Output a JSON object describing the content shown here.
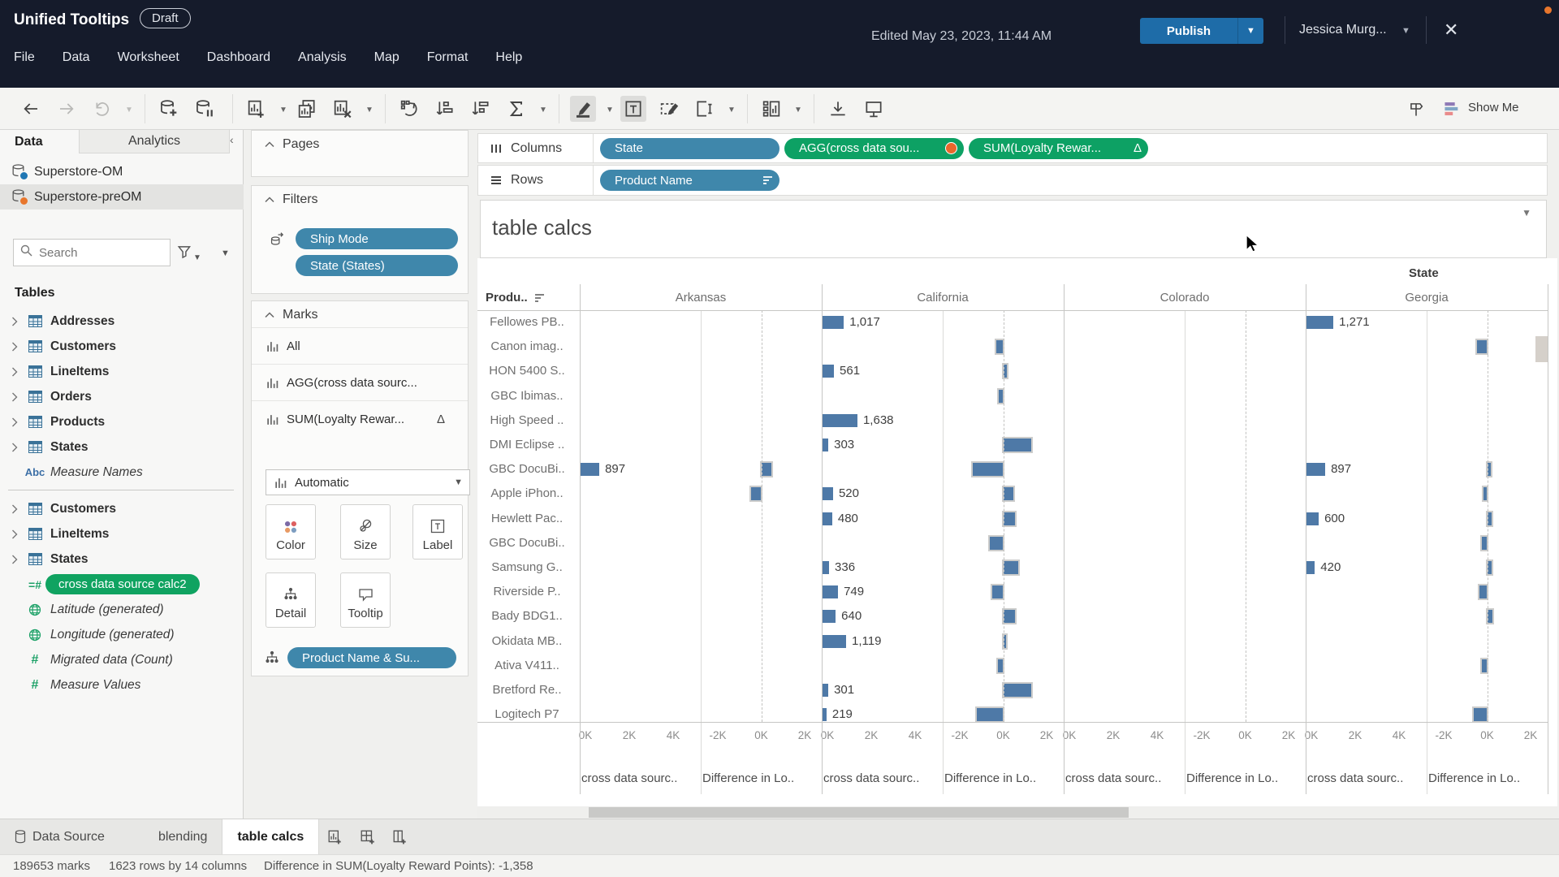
{
  "window": {
    "title": "Unified Tooltips",
    "badge": "Draft",
    "edited": "Edited May 23, 2023, 11:44 AM",
    "publish_label": "Publish",
    "user": "Jessica Murg...",
    "close_glyph": "✕"
  },
  "menu": {
    "items": [
      "File",
      "Data",
      "Worksheet",
      "Dashboard",
      "Analysis",
      "Map",
      "Format",
      "Help"
    ]
  },
  "toolbar": {
    "show_me": "Show Me",
    "items": [
      {
        "name": "undo"
      },
      {
        "name": "redo",
        "disabled": true
      },
      {
        "name": "replay",
        "disabled": true,
        "caret": true
      },
      {
        "sep": true
      },
      {
        "name": "new-data-source"
      },
      {
        "name": "pause-auto-updates"
      },
      {
        "sep": true
      },
      {
        "name": "new-worksheet",
        "caret": true
      },
      {
        "name": "duplicate-sheet"
      },
      {
        "name": "clear-sheet",
        "caret": true
      },
      {
        "sep": true
      },
      {
        "name": "swap-rows-columns"
      },
      {
        "name": "sort-ascending"
      },
      {
        "name": "sort-descending"
      },
      {
        "name": "totals",
        "caret": true
      },
      {
        "sep": true
      },
      {
        "name": "highlight",
        "caret": true,
        "active": true
      },
      {
        "name": "show-mark-labels",
        "active": true
      },
      {
        "name": "fix-axes"
      },
      {
        "name": "fit",
        "caret": true
      },
      {
        "sep": true
      },
      {
        "name": "show-cards",
        "caret": true
      },
      {
        "sep": true
      },
      {
        "name": "download"
      },
      {
        "name": "presentation-mode"
      }
    ]
  },
  "data_pane": {
    "tab_data": "Data",
    "tab_analytics": "Analytics",
    "collapse_glyph": "‹",
    "sources": [
      {
        "name": "Superstore-OM",
        "dot_color": "#1f77b4",
        "selected": false
      },
      {
        "name": "Superstore-preOM",
        "dot_color": "#e8762c",
        "selected": true
      }
    ],
    "search_placeholder": "Search",
    "tables_label": "Tables",
    "fields": [
      {
        "icon": "table",
        "label": "Addresses"
      },
      {
        "icon": "table",
        "label": "Customers"
      },
      {
        "icon": "table",
        "label": "LineItems"
      },
      {
        "icon": "table",
        "label": "Orders"
      },
      {
        "icon": "table",
        "label": "Products"
      },
      {
        "icon": "table",
        "label": "States"
      },
      {
        "icon": "abc",
        "label": "Measure Names",
        "italic": true
      },
      {
        "divider": true
      },
      {
        "icon": "table",
        "label": "Customers"
      },
      {
        "icon": "table",
        "label": "LineItems"
      },
      {
        "icon": "table",
        "label": "States"
      },
      {
        "icon": "calc",
        "label": "cross data source calc2",
        "pill": true
      },
      {
        "icon": "globe",
        "label": "Latitude (generated)",
        "italic": true
      },
      {
        "icon": "globe",
        "label": "Longitude (generated)",
        "italic": true
      },
      {
        "icon": "hash",
        "label": "Migrated data (Count)",
        "italic": true
      },
      {
        "icon": "hash",
        "label": "Measure Values",
        "italic": true
      }
    ]
  },
  "cards": {
    "pages_label": "Pages",
    "filters_label": "Filters",
    "filter_pills": [
      {
        "label": "Ship Mode",
        "multi_source": true
      },
      {
        "label": "State (States)",
        "multi_source": false
      }
    ],
    "marks_label": "Marks",
    "mark_layers": [
      {
        "label": "All"
      },
      {
        "label": "AGG(cross data sourc..."
      },
      {
        "label": "SUM(Loyalty Rewar...",
        "delta": "Δ"
      }
    ],
    "mark_type": "Automatic",
    "btn_color": "Color",
    "btn_size": "Size",
    "btn_label": "Label",
    "btn_detail": "Detail",
    "btn_tooltip": "Tooltip",
    "detail_pill": "Product Name & Su..."
  },
  "shelves": {
    "columns_label": "Columns",
    "rows_label": "Rows",
    "column_pills": [
      {
        "label": "State",
        "color": "blue"
      },
      {
        "label": "AGG(cross data sou...",
        "color": "green",
        "orange_dot": true
      },
      {
        "label": "SUM(Loyalty Rewar...",
        "color": "green",
        "delta": "Δ"
      }
    ],
    "row_pills": [
      {
        "label": "Product Name",
        "color": "blue",
        "sort": true
      }
    ]
  },
  "sheet": {
    "title": "table calcs"
  },
  "chart_data": {
    "type": "bar",
    "orientation": "horizontal",
    "title": "table calcs",
    "col_header": "State",
    "row_header": "Produ..",
    "states": [
      "Arkansas",
      "California",
      "Colorado",
      "Georgia"
    ],
    "products": [
      "Fellowes PB..",
      "Canon imag..",
      "HON 5400 S..",
      "GBC Ibimas..",
      "High Speed ..",
      "DMI Eclipse ..",
      "GBC DocuBi..",
      "Apple iPhon..",
      "Hewlett Pac..",
      "GBC DocuBi..",
      "Samsung G..",
      "Riverside P..",
      "Bady BDG1..",
      "Okidata MB..",
      "Ativa V411..",
      "Bretford Re..",
      "Logitech P7"
    ],
    "axes": {
      "cross": {
        "ticks": [
          "0K",
          "2K",
          "4K"
        ],
        "caption": "cross data sourc..",
        "range": [
          0,
          5550
        ]
      },
      "diff": {
        "ticks": [
          "-2K",
          "0K",
          "2K"
        ],
        "caption": "Difference in Lo..",
        "range": [
          -2775,
          2775
        ]
      }
    },
    "series": [
      {
        "state": "Arkansas",
        "cross": [
          null,
          null,
          null,
          null,
          null,
          null,
          897,
          null,
          null,
          null,
          null,
          null,
          null,
          null,
          null,
          null,
          null
        ],
        "diff": [
          null,
          null,
          null,
          null,
          null,
          null,
          450,
          -450,
          null,
          null,
          null,
          null,
          null,
          null,
          null,
          null,
          null
        ]
      },
      {
        "state": "California",
        "cross": [
          1017,
          null,
          561,
          null,
          1638,
          303,
          null,
          520,
          480,
          null,
          336,
          749,
          640,
          1119,
          null,
          301,
          219
        ],
        "diff": [
          null,
          -300,
          150,
          -200,
          null,
          1300,
          -1400,
          450,
          550,
          -600,
          700,
          -500,
          550,
          100,
          -250,
          1300,
          -1200
        ]
      },
      {
        "state": "Colorado",
        "cross": [
          null,
          null,
          null,
          null,
          null,
          null,
          null,
          null,
          null,
          null,
          null,
          null,
          null,
          null,
          null,
          null,
          null
        ],
        "diff": [
          null,
          null,
          null,
          null,
          null,
          null,
          null,
          null,
          null,
          null,
          null,
          null,
          null,
          null,
          null,
          null,
          null
        ]
      },
      {
        "state": "Georgia",
        "cross": [
          1271,
          null,
          null,
          null,
          null,
          null,
          897,
          null,
          600,
          null,
          420,
          null,
          null,
          null,
          null,
          null,
          null
        ],
        "diff": [
          null,
          -450,
          null,
          null,
          null,
          null,
          150,
          -150,
          200,
          -250,
          200,
          -350,
          250,
          null,
          -250,
          null,
          -600
        ]
      }
    ],
    "bar_color": "#4e79a7",
    "grid": true,
    "legend": "none"
  },
  "tabs": {
    "datasource": "Data Source",
    "sheets": [
      "blending",
      "table calcs"
    ],
    "active": "table calcs"
  },
  "status": {
    "marks": "189653 marks",
    "size": "1623 rows by 14 columns",
    "info": "Difference in SUM(Loyalty Reward Points): -1,358"
  }
}
